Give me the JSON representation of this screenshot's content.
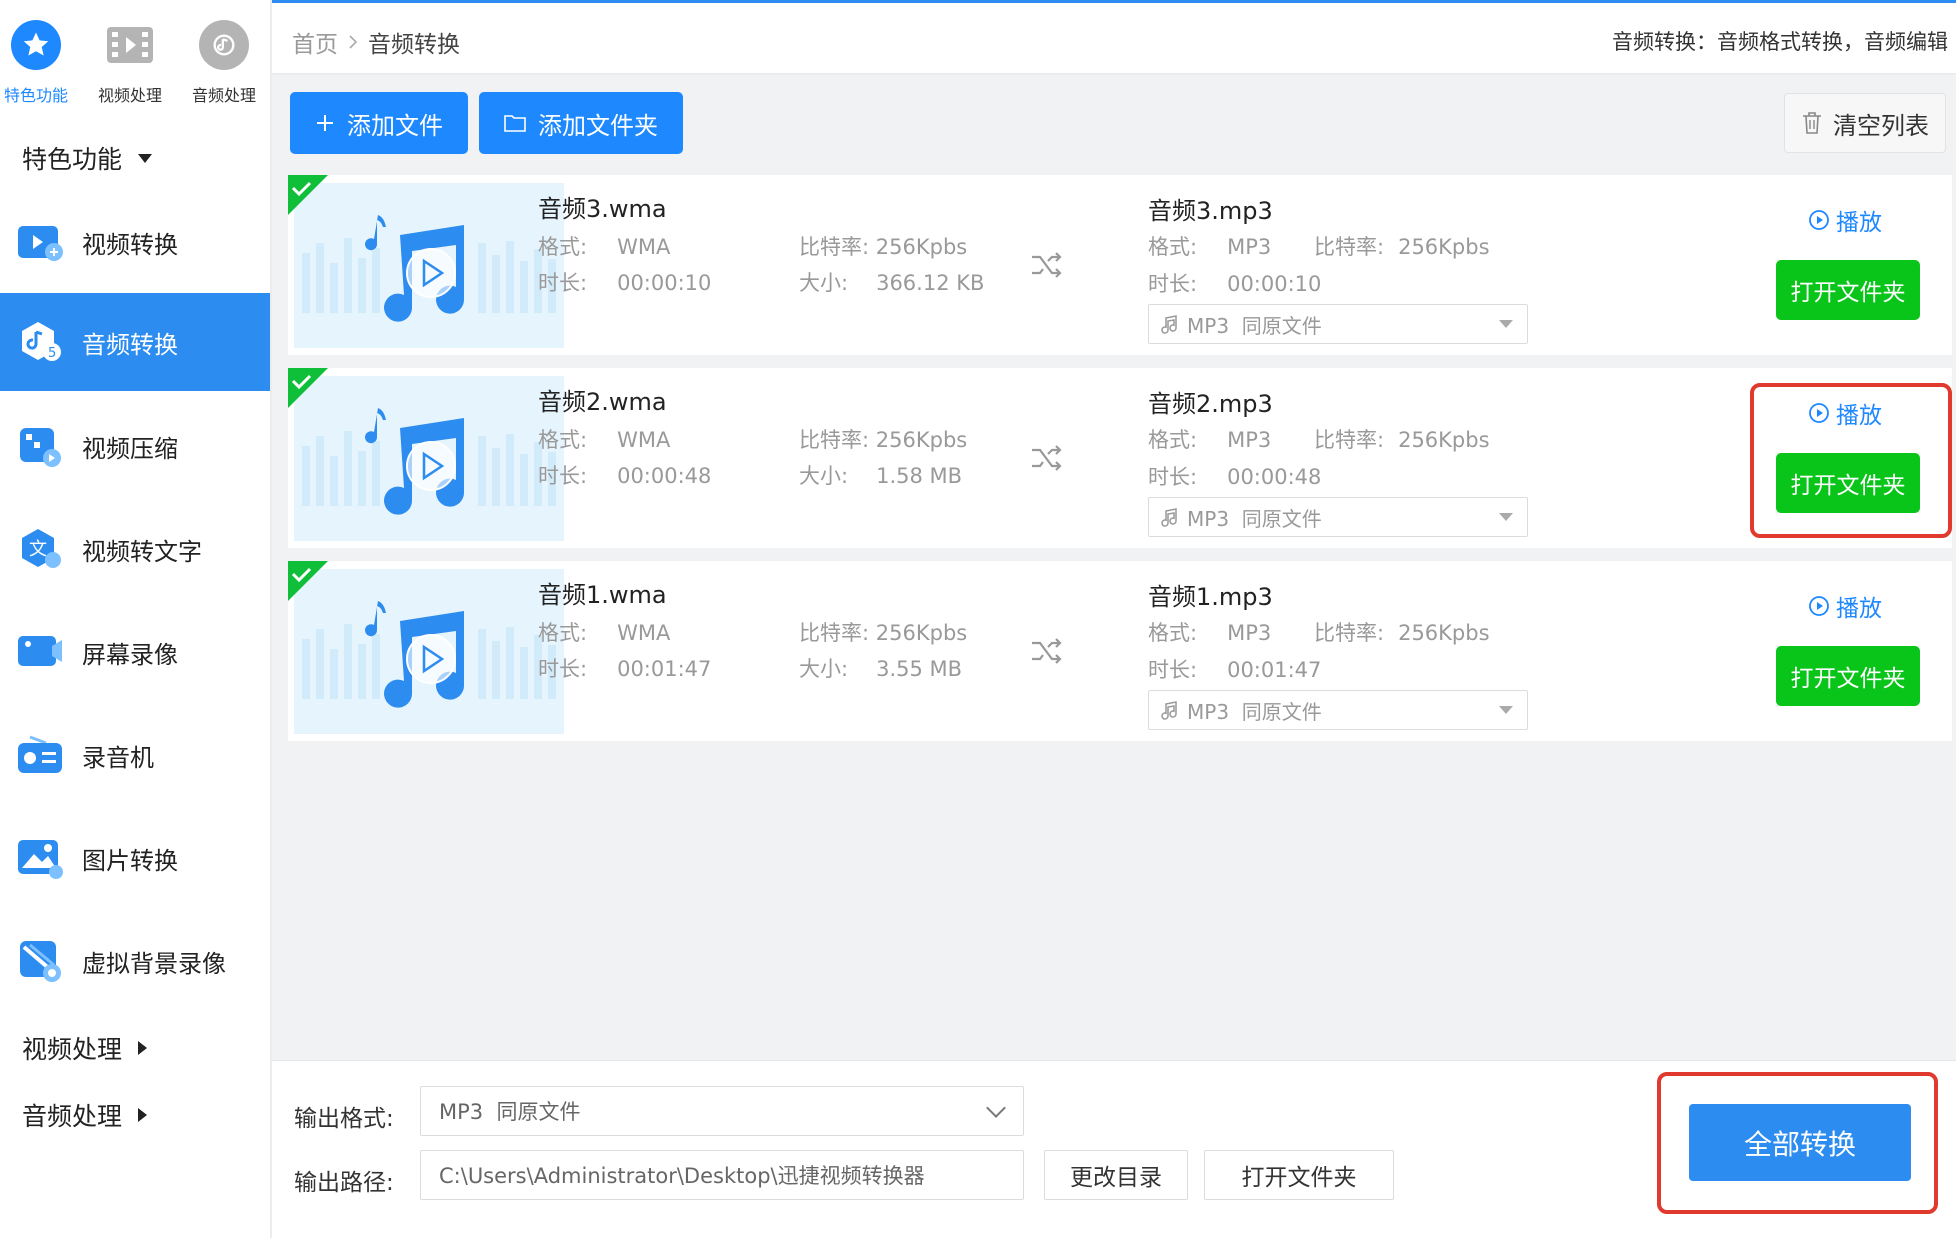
{
  "topbar": {
    "tabs": [
      {
        "label": "特色功能",
        "icon": "star-icon",
        "active": true
      },
      {
        "label": "视频处理",
        "icon": "film-icon",
        "active": false
      },
      {
        "label": "音频处理",
        "icon": "audio-icon",
        "active": false
      }
    ]
  },
  "sidebar": {
    "group_featured": "特色功能",
    "items": [
      {
        "label": "视频转换",
        "icon": "video-convert-icon"
      },
      {
        "label": "音频转换",
        "icon": "audio-convert-icon",
        "active": true
      },
      {
        "label": "视频压缩",
        "icon": "video-compress-icon"
      },
      {
        "label": "视频转文字",
        "icon": "video-to-text-icon"
      },
      {
        "label": "屏幕录像",
        "icon": "screen-record-icon"
      },
      {
        "label": "录音机",
        "icon": "recorder-icon"
      },
      {
        "label": "图片转换",
        "icon": "image-convert-icon"
      },
      {
        "label": "虚拟背景录像",
        "icon": "virtual-bg-icon"
      }
    ],
    "group_video": "视频处理",
    "group_audio": "音频处理"
  },
  "header": {
    "breadcrumb_home": "首页",
    "breadcrumb_current": "音频转换",
    "description": "音频转换：音频格式转换，音频编辑"
  },
  "toolbar": {
    "add_file": "添加文件",
    "add_folder": "添加文件夹",
    "clear_list": "清空列表"
  },
  "labels": {
    "format": "格式:",
    "bitrate": "比特率:",
    "duration": "时长:",
    "size": "大小:",
    "play": "播放",
    "open_folder": "打开文件夹"
  },
  "files": [
    {
      "src_name": "音频3.wma",
      "src_format": "WMA",
      "src_bitrate": "256Kpbs",
      "src_duration": "00:00:10",
      "src_size": "366.12 KB",
      "out_name": "音频3.mp3",
      "out_format": "MP3",
      "out_bitrate": "256Kpbs",
      "out_duration": "00:00:10",
      "out_select": "MP3  同原文件"
    },
    {
      "src_name": "音频2.wma",
      "src_format": "WMA",
      "src_bitrate": "256Kpbs",
      "src_duration": "00:00:48",
      "src_size": "1.58 MB",
      "out_name": "音频2.mp3",
      "out_format": "MP3",
      "out_bitrate": "256Kpbs",
      "out_duration": "00:00:48",
      "out_select": "MP3  同原文件"
    },
    {
      "src_name": "音频1.wma",
      "src_format": "WMA",
      "src_bitrate": "256Kpbs",
      "src_duration": "00:01:47",
      "src_size": "3.55 MB",
      "out_name": "音频1.mp3",
      "out_format": "MP3",
      "out_bitrate": "256Kpbs",
      "out_duration": "00:01:47",
      "out_select": "MP3  同原文件"
    }
  ],
  "bottom": {
    "output_format_label": "输出格式:",
    "output_format_value": "MP3  同原文件",
    "output_path_label": "输出路径:",
    "output_path_value": "C:\\Users\\Administrator\\Desktop\\迅捷视频转换器",
    "change_dir": "更改目录",
    "open_folder": "打开文件夹",
    "convert_all": "全部转换"
  },
  "colors": {
    "accent": "#2d8cf0",
    "green": "#09c519",
    "highlight": "#e03a2e"
  }
}
